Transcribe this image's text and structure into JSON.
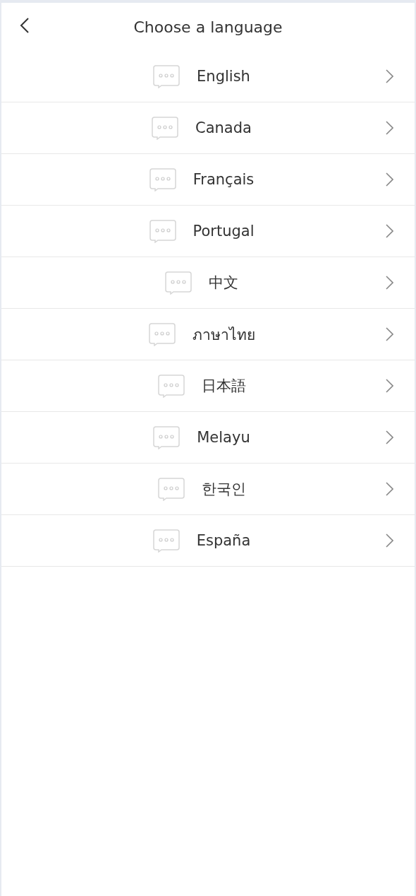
{
  "header": {
    "title": "Choose a language"
  },
  "languages": [
    {
      "label": "English"
    },
    {
      "label": "Canada"
    },
    {
      "label": "Français"
    },
    {
      "label": "Portugal"
    },
    {
      "label": "中文"
    },
    {
      "label": "ภาษาไทย"
    },
    {
      "label": "日本語"
    },
    {
      "label": "Melayu"
    },
    {
      "label": "한국인"
    },
    {
      "label": "España"
    }
  ]
}
